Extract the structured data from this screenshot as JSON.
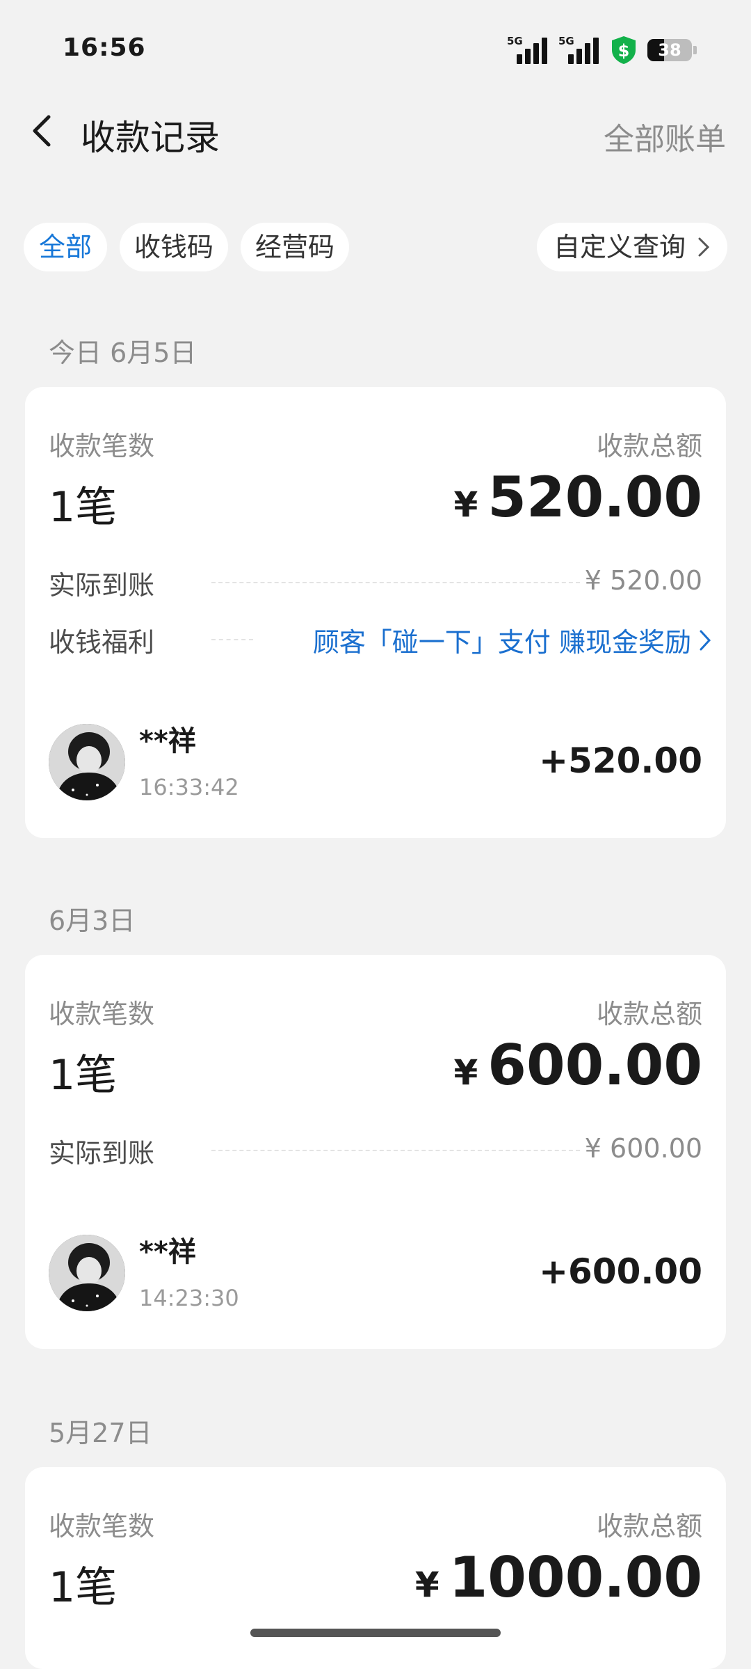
{
  "status_bar": {
    "time": "16:56",
    "signal_1": "5G",
    "signal_2": "5G",
    "battery": "38",
    "battery_level": 0.38
  },
  "header": {
    "title": "收款记录",
    "all_bills": "全部账单"
  },
  "filters": {
    "tabs": [
      "全部",
      "收钱码",
      "经营码"
    ],
    "active_index": 0,
    "custom_query": "自定义查询"
  },
  "sections": [
    {
      "date": "今日 6月5日",
      "count_label": "收款笔数",
      "count": "1笔",
      "total_label": "收款总额",
      "currency": "¥",
      "total": "520.00",
      "actual_label": "实际到账",
      "actual_value": "¥ 520.00",
      "benefit_label": "收钱福利",
      "benefit_text": "顾客「碰一下」支付 赚现金奖励",
      "tx": {
        "name": "**祥",
        "time": "16:33:42",
        "amount": "+520.00"
      }
    },
    {
      "date": "6月3日",
      "count_label": "收款笔数",
      "count": "1笔",
      "total_label": "收款总额",
      "currency": "¥",
      "total": "600.00",
      "actual_label": "实际到账",
      "actual_value": "¥ 600.00",
      "tx": {
        "name": "**祥",
        "time": "14:23:30",
        "amount": "+600.00"
      }
    },
    {
      "date": "5月27日",
      "count_label": "收款笔数",
      "count": "1笔",
      "total_label": "收款总额",
      "currency": "¥",
      "total": "1000.00"
    }
  ]
}
